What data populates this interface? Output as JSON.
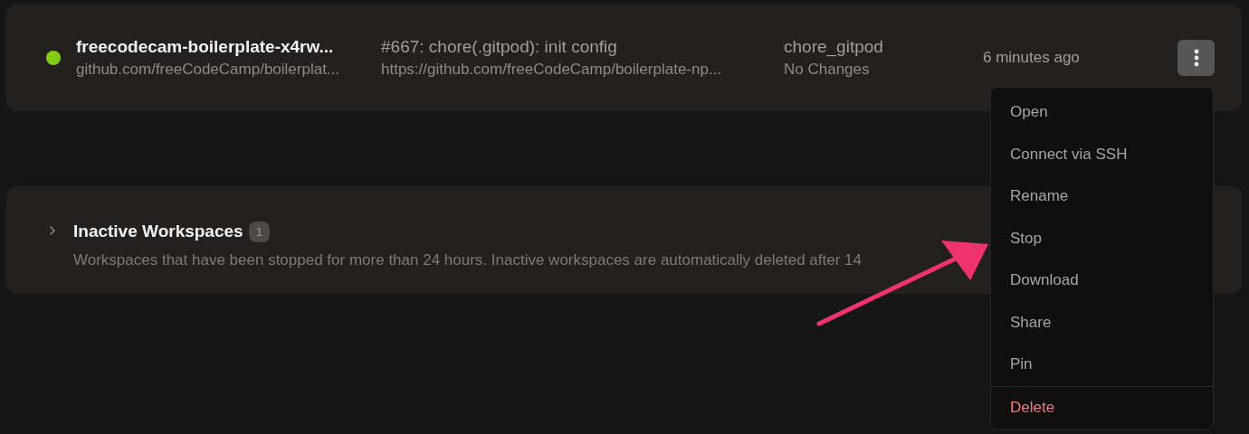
{
  "workspace": {
    "color": "#84cc16",
    "name": "freecodecam-boilerplate-x4rw...",
    "repo": "github.com/freeCodeCamp/boilerplat...",
    "context_title": "#667: chore(.gitpod): init config",
    "context_url": "https://github.com/freeCodeCamp/boilerplate-np...",
    "branch": "chore_gitpod",
    "changes": "No Changes",
    "time": "6 minutes ago",
    "menu_open": true
  },
  "inactive": {
    "expanded": false,
    "title": "Inactive Workspaces",
    "count": "1",
    "description": "Workspaces that have been stopped for more than 24 hours. Inactive workspaces are automatically deleted after 14"
  },
  "menu": [
    {
      "label": "Open",
      "kind": "normal"
    },
    {
      "label": "Connect via SSH",
      "kind": "normal"
    },
    {
      "label": "Rename",
      "kind": "normal"
    },
    {
      "label": "Stop",
      "kind": "normal"
    },
    {
      "label": "Download",
      "kind": "normal"
    },
    {
      "label": "Share",
      "kind": "normal"
    },
    {
      "label": "Pin",
      "kind": "normal"
    },
    {
      "label": "Delete",
      "kind": "danger"
    }
  ]
}
